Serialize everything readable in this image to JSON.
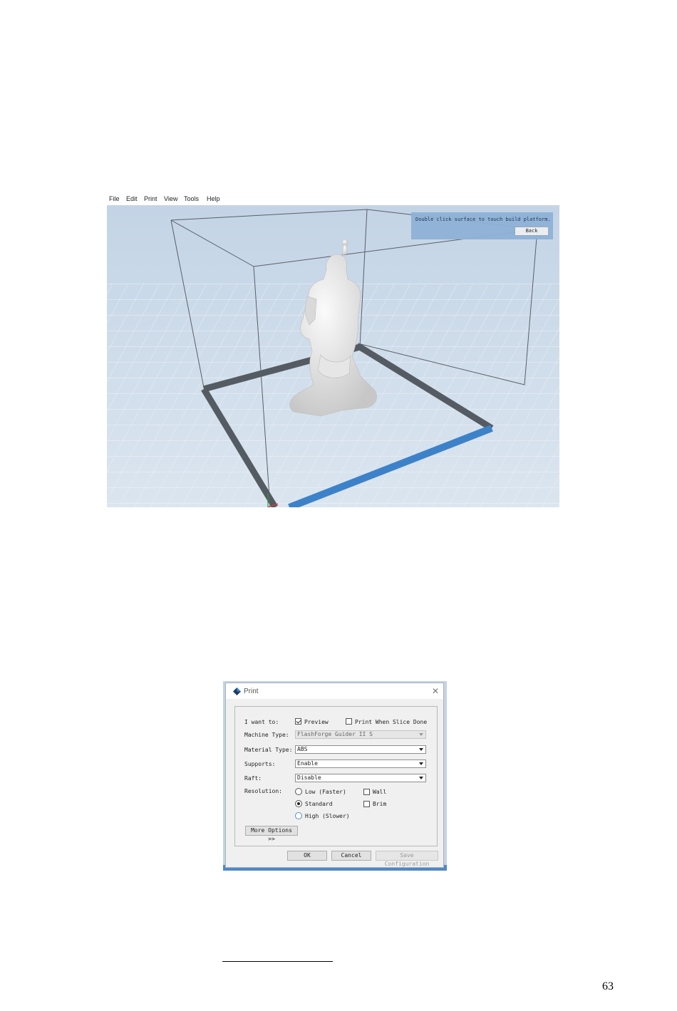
{
  "main_window": {
    "menu": [
      "File",
      "Edit",
      "Print",
      "View",
      "Tools",
      "Help"
    ],
    "tip": "Double click surface to touch build platform.",
    "back_label": "Back"
  },
  "print_dialog": {
    "title": "Print",
    "i_want_to_label": "I want to:",
    "preview_label": "Preview",
    "preview_checked": true,
    "print_when_done_label": "Print When Slice Done",
    "print_when_done_checked": false,
    "machine_type_label": "Machine Type:",
    "machine_type_value": "FlashForge Guider II S",
    "material_type_label": "Material Type:",
    "material_type_value": "ABS",
    "supports_label": "Supports:",
    "supports_value": "Enable",
    "raft_label": "Raft:",
    "raft_value": "Disable",
    "resolution_label": "Resolution:",
    "resolution_options": [
      "Low (Faster)",
      "Standard",
      "High (Slower)"
    ],
    "resolution_selected": "Standard",
    "wall_label": "Wall",
    "brim_label": "Brim",
    "more_options_label": "More Options >>",
    "ok_label": "OK",
    "cancel_label": "Cancel",
    "save_config_label": "Save Configuration"
  },
  "page_number": "63"
}
